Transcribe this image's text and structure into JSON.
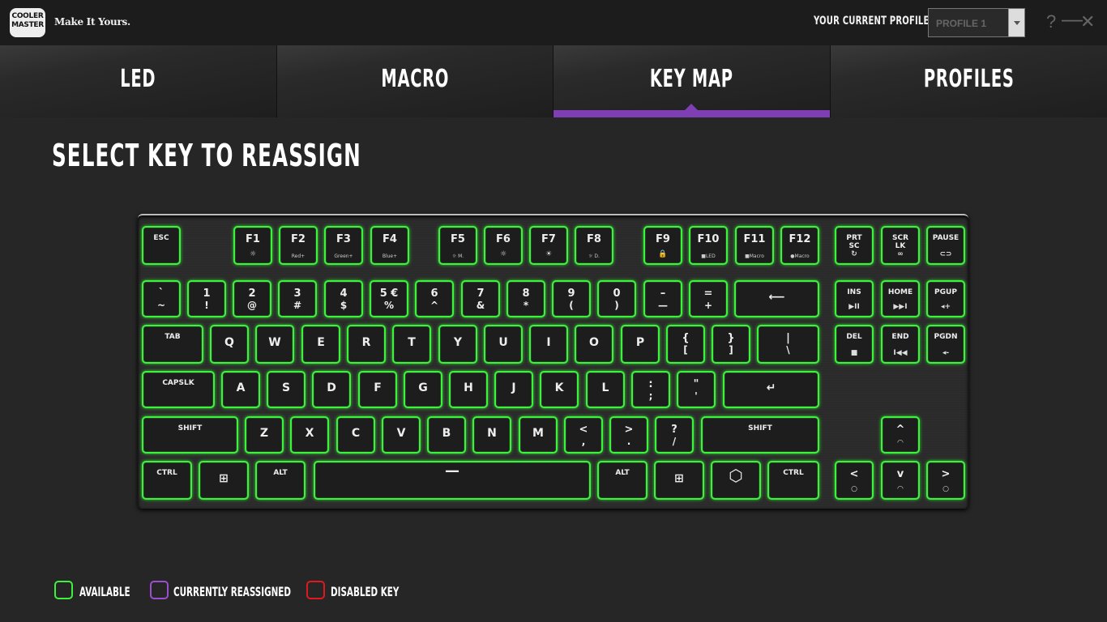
{
  "brand": {
    "logo_text": "COOLER MASTER",
    "tagline": "Make It Yours."
  },
  "header": {
    "profile_label": "YOUR CURRENT PROFILE",
    "profile_value": "PROFILE 1",
    "help_label": "?",
    "minimize_label": "—",
    "close_label": "✕"
  },
  "tabs": [
    {
      "label": "LED",
      "active": false
    },
    {
      "label": "MACRO",
      "active": false
    },
    {
      "label": "KEY MAP",
      "active": true
    },
    {
      "label": "PROFILES",
      "active": false
    }
  ],
  "main": {
    "title": "SELECT KEY TO REASSIGN"
  },
  "keys": [
    {
      "id": "esc",
      "l1": "ESC",
      "style": "sm"
    },
    {
      "id": "f1",
      "l1": "F1",
      "icon": "☼"
    },
    {
      "id": "f2",
      "l1": "F2",
      "sub": "Red+"
    },
    {
      "id": "f3",
      "l1": "F3",
      "sub": "Green+"
    },
    {
      "id": "f4",
      "l1": "F4",
      "sub": "Blue+"
    },
    {
      "id": "f5",
      "l1": "F5",
      "sub": "☼ M."
    },
    {
      "id": "f6",
      "l1": "F6",
      "icon": "☼"
    },
    {
      "id": "f7",
      "l1": "F7",
      "icon": "☀"
    },
    {
      "id": "f8",
      "l1": "F8",
      "sub": "☼ D."
    },
    {
      "id": "f9",
      "l1": "F9",
      "icon": "🔒"
    },
    {
      "id": "f10",
      "l1": "F10",
      "sub": "■LED"
    },
    {
      "id": "f11",
      "l1": "F11",
      "sub": "■Macro"
    },
    {
      "id": "f12",
      "l1": "F12",
      "sub": "●Macro"
    },
    {
      "id": "prtsc",
      "l1": "PRT\nSC",
      "style": "sm",
      "icon": "↻"
    },
    {
      "id": "scrlk",
      "l1": "SCR\nLK",
      "style": "sm",
      "icon": "∞"
    },
    {
      "id": "pause",
      "l1": "PAUSE",
      "style": "sm",
      "icon": "⊂⊃"
    },
    {
      "id": "grave",
      "l1": "`",
      "l2": "~"
    },
    {
      "id": "k1",
      "l1": "1",
      "l2": "!"
    },
    {
      "id": "k2",
      "l1": "2",
      "l2": "@"
    },
    {
      "id": "k3",
      "l1": "3",
      "l2": "#"
    },
    {
      "id": "k4",
      "l1": "4",
      "l2": "$"
    },
    {
      "id": "k5",
      "l1": "5 €",
      "l2": "%"
    },
    {
      "id": "k6",
      "l1": "6",
      "l2": "^"
    },
    {
      "id": "k7",
      "l1": "7",
      "l2": "&"
    },
    {
      "id": "k8",
      "l1": "8",
      "l2": "*"
    },
    {
      "id": "k9",
      "l1": "9",
      "l2": "("
    },
    {
      "id": "k0",
      "l1": "0",
      "l2": ")"
    },
    {
      "id": "minus",
      "l1": "–",
      "l2": "—"
    },
    {
      "id": "equal",
      "l1": "=",
      "l2": "+"
    },
    {
      "id": "backspace",
      "l1": "⟵"
    },
    {
      "id": "ins",
      "l1": "INS",
      "style": "sm",
      "icon": "▶II"
    },
    {
      "id": "home",
      "l1": "HOME",
      "style": "sm",
      "icon": "▶▶I"
    },
    {
      "id": "pgup",
      "l1": "PGUP",
      "style": "sm",
      "icon": "◂+"
    },
    {
      "id": "tab",
      "l1": "TAB",
      "style": "sm"
    },
    {
      "id": "q",
      "l1": "Q"
    },
    {
      "id": "w",
      "l1": "W"
    },
    {
      "id": "e",
      "l1": "E"
    },
    {
      "id": "r",
      "l1": "R"
    },
    {
      "id": "t",
      "l1": "T"
    },
    {
      "id": "y",
      "l1": "Y"
    },
    {
      "id": "u",
      "l1": "U"
    },
    {
      "id": "i",
      "l1": "I"
    },
    {
      "id": "o",
      "l1": "O"
    },
    {
      "id": "p",
      "l1": "P"
    },
    {
      "id": "lbracket",
      "l1": "{",
      "l2": "["
    },
    {
      "id": "rbracket",
      "l1": "}",
      "l2": "]"
    },
    {
      "id": "backslash",
      "l1": "|",
      "l2": "\\"
    },
    {
      "id": "del",
      "l1": "DEL",
      "style": "sm",
      "icon": "■"
    },
    {
      "id": "end",
      "l1": "END",
      "style": "sm",
      "icon": "I◀◀"
    },
    {
      "id": "pgdn",
      "l1": "PGDN",
      "style": "sm",
      "icon": "◂-"
    },
    {
      "id": "capslk",
      "l1": "CAPSLK",
      "style": "sm"
    },
    {
      "id": "a",
      "l1": "A"
    },
    {
      "id": "s",
      "l1": "S"
    },
    {
      "id": "d",
      "l1": "D"
    },
    {
      "id": "f",
      "l1": "F"
    },
    {
      "id": "g",
      "l1": "G"
    },
    {
      "id": "h",
      "l1": "H"
    },
    {
      "id": "j",
      "l1": "J"
    },
    {
      "id": "k",
      "l1": "K"
    },
    {
      "id": "l",
      "l1": "L"
    },
    {
      "id": "semicolon",
      "l1": ":",
      "l2": ";"
    },
    {
      "id": "quote",
      "l1": "\"",
      "l2": "'"
    },
    {
      "id": "enter",
      "l1": "↵"
    },
    {
      "id": "lshift",
      "l1": "SHIFT",
      "style": "sm"
    },
    {
      "id": "z",
      "l1": "Z"
    },
    {
      "id": "x",
      "l1": "X"
    },
    {
      "id": "c",
      "l1": "C"
    },
    {
      "id": "v",
      "l1": "V"
    },
    {
      "id": "b",
      "l1": "B"
    },
    {
      "id": "n",
      "l1": "N"
    },
    {
      "id": "m",
      "l1": "M"
    },
    {
      "id": "comma",
      "l1": "<",
      "l2": ","
    },
    {
      "id": "period",
      "l1": ">",
      "l2": "."
    },
    {
      "id": "slash",
      "l1": "?",
      "l2": "/"
    },
    {
      "id": "rshift",
      "l1": "SHIFT",
      "style": "sm"
    },
    {
      "id": "up",
      "l1": "^",
      "icon": "◠"
    },
    {
      "id": "lctrl",
      "l1": "CTRL",
      "style": "sm"
    },
    {
      "id": "lwin",
      "l1": "⊞"
    },
    {
      "id": "lalt",
      "l1": "ALT",
      "style": "sm"
    },
    {
      "id": "space",
      "l1": "—"
    },
    {
      "id": "ralt",
      "l1": "ALT",
      "style": "sm"
    },
    {
      "id": "rwin",
      "l1": "⊞"
    },
    {
      "id": "fn",
      "l1": "⬡"
    },
    {
      "id": "rctrl",
      "l1": "CTRL",
      "style": "sm"
    },
    {
      "id": "left",
      "l1": "<",
      "icon": "○"
    },
    {
      "id": "down",
      "l1": "v",
      "icon": "◠"
    },
    {
      "id": "right",
      "l1": ">",
      "icon": "○"
    }
  ],
  "legend": [
    {
      "label": "AVAILABLE",
      "color": "#3df23d"
    },
    {
      "label": "CURRENTLY REASSIGNED",
      "color": "#9b4fd0"
    },
    {
      "label": "DISABLED KEY",
      "color": "#e0191f"
    }
  ],
  "colors": {
    "accent": "#7e3fb5",
    "key_glow": "#3df23d"
  }
}
